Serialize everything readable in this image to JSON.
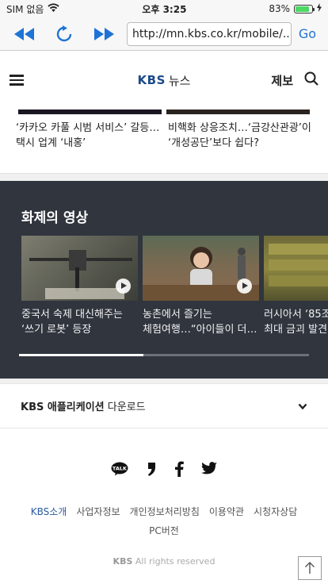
{
  "status_bar": {
    "carrier": "SIM 없음",
    "time": "오후 3:25",
    "battery": "83%",
    "battery_level": 0.83
  },
  "browser": {
    "url": "http://mn.kbs.co.kr/mobile/...",
    "go_label": "Go"
  },
  "header": {
    "logo_kbs": "KBS",
    "logo_news": "뉴스",
    "report_label": "제보"
  },
  "news": [
    {
      "title": "‘카카오 카풀 시범 서비스’ 갈등…택시 업계 ‘내홍’"
    },
    {
      "title": "비핵화 상응조치…‘금강산관광’이 ‘개성공단’보다 쉽다?"
    }
  ],
  "video_section": {
    "title": "화제의 영상",
    "items": [
      {
        "title": "중국서 숙제 대신해주는\n‘쓰기 로봇’ 등장"
      },
      {
        "title": "농촌에서 즐기는\n체험여행…“아이들이 더…"
      },
      {
        "title": "러시아서 ‘85조\n최대 금괴 발견"
      }
    ],
    "progress": 0.43
  },
  "app_download": {
    "brand": "KBS 애플리케이션",
    "rest": " 다운로드"
  },
  "footer": {
    "links": [
      "KBS소개",
      "사업자정보",
      "개인정보처리방침",
      "이용약관",
      "시청자상담",
      "PC버전"
    ],
    "copyright_brand": "KBS",
    "copyright_rest": " All rights reserved"
  },
  "colors": {
    "video_bg": "#30353e",
    "kbs_blue": "#1b4a8a",
    "go_blue": "#1e74d6",
    "battery_green": "#4cd964"
  }
}
